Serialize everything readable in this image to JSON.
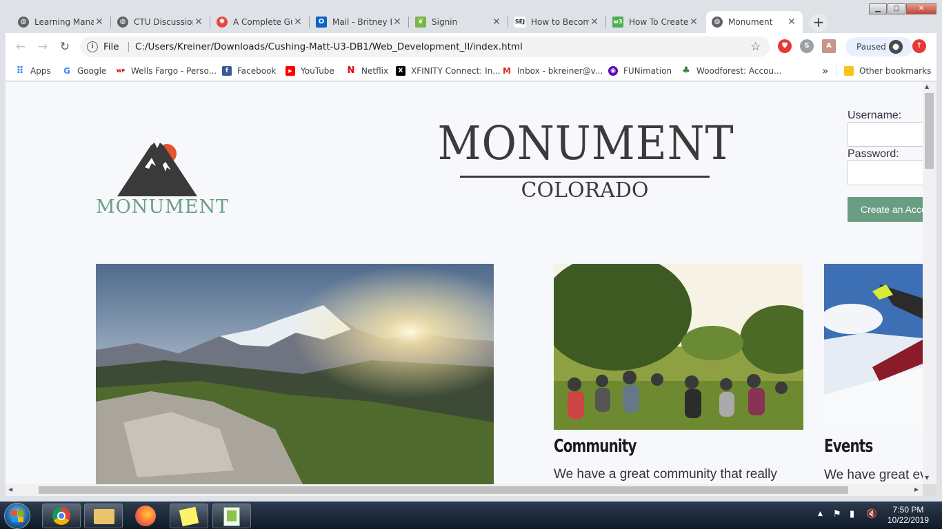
{
  "browser": {
    "tabs": [
      {
        "title": "Learning Mana",
        "icon": "globe-icon",
        "color": "#5f6368"
      },
      {
        "title": "CTU Discussion",
        "icon": "globe-icon",
        "color": "#5f6368"
      },
      {
        "title": "A Complete Gu",
        "icon": "asterisk-icon",
        "color": "#e8453c"
      },
      {
        "title": "Mail - Britney K",
        "icon": "outlook-icon",
        "color": "#0a64c8"
      },
      {
        "title": "Signin",
        "icon": "leaf-icon",
        "color": "#7ab648"
      },
      {
        "title": "How to Becom",
        "icon": "sej-icon",
        "color": "#222222"
      },
      {
        "title": "How To Create",
        "icon": "w3-icon",
        "color": "#4caf50"
      },
      {
        "title": "Monument",
        "icon": "globe-icon",
        "color": "#5f6368"
      }
    ],
    "new_tab_label": "+",
    "address": {
      "scheme_label": "File",
      "url": "C:/Users/Kreiner/Downloads/Cushing-Matt-U3-DB1/Web_Development_II/index.html"
    },
    "profile_status": "Paused",
    "bookmarks": [
      {
        "label": "Apps",
        "icon": "apps-grid-icon",
        "color": "#4285f4"
      },
      {
        "label": "Google",
        "icon": "google-icon",
        "color": "#4285f4"
      },
      {
        "label": "Wells Fargo - Perso...",
        "icon": "wellsfargo-icon",
        "color": "#cc0000"
      },
      {
        "label": "Facebook",
        "icon": "facebook-icon",
        "color": "#3b5998"
      },
      {
        "label": "YouTube",
        "icon": "youtube-icon",
        "color": "#ff0000"
      },
      {
        "label": "Netflix",
        "icon": "netflix-icon",
        "color": "#e50914"
      },
      {
        "label": "XFINITY Connect: In...",
        "icon": "xfinity-icon",
        "color": "#000000"
      },
      {
        "label": "Inbox - bkreiner@v...",
        "icon": "gmail-icon",
        "color": "#d93025"
      },
      {
        "label": "FUNimation",
        "icon": "funimation-icon",
        "color": "#5b0bb5"
      },
      {
        "label": "Woodforest: Accou...",
        "icon": "woodforest-icon",
        "color": "#2e7d32"
      }
    ],
    "overflow_label": "»",
    "other_bookmarks": "Other bookmarks"
  },
  "site": {
    "logo_text": "MONUMENT",
    "title_main": "MONUMENT",
    "title_sub": "COLORADO",
    "login": {
      "username_label": "Username:",
      "password_label": "Password:",
      "create_label": "Create an Account"
    },
    "cards": [
      {
        "heading": "Community",
        "text": "We have a great community that really"
      },
      {
        "heading": "Events",
        "text": "We have great events"
      }
    ]
  },
  "taskbar": {
    "time": "7:50 PM",
    "date": "10/22/2019",
    "apps": [
      "chrome-icon",
      "file-explorer-icon",
      "firefox-icon",
      "sticky-notes-icon",
      "notepad-plus-icon"
    ]
  },
  "colors": {
    "accent_green": "#6a9e83",
    "logo_orange": "#e2562b",
    "page_bg": "#f7f8fc"
  }
}
